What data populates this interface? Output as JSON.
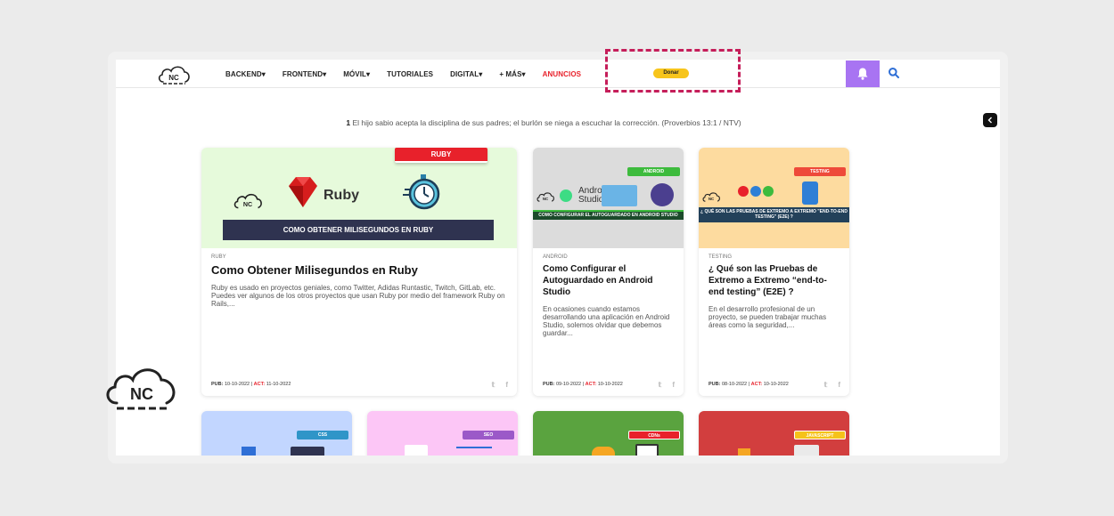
{
  "header": {
    "nav": [
      {
        "label": "BACKEND▾"
      },
      {
        "label": "FRONTEND▾"
      },
      {
        "label": "MÓVIL▾"
      },
      {
        "label": "TUTORIALES"
      },
      {
        "label": "DIGITAL▾"
      },
      {
        "label": "+ MÁS▾"
      },
      {
        "label": "ANUNCIOS"
      }
    ],
    "donate_label": "Donar",
    "logo_text": "NC"
  },
  "verse": {
    "number": "1",
    "text": " El hijo sabio acepta la disciplina de sus padres; el burlón se niega a escuchar la corrección. (Proverbios 13:1 / NTV)"
  },
  "cards": [
    {
      "tag": "RUBY",
      "image_brand": "Ruby",
      "image_banner": "COMO OBTENER MILISEGUNDOS EN RUBY",
      "category": "RUBY",
      "title": "Como Obtener Milisegundos en Ruby",
      "excerpt": "Ruby es usado en proyectos geniales, como Twitter, Adidas Runtastic, Twitch, GitLab, etc. Puedes ver algunos de los otros proyectos que usan Ruby por medio del framework Ruby on Rails,...",
      "pub_label": "PUB:",
      "pub": "10-10-2022",
      "act_label": "ACT:",
      "act": "11-10-2022"
    },
    {
      "tag": "ANDROID",
      "image_brand": "Android Studio",
      "image_banner": "COMO CONFIGURAR EL AUTOGUARDADO EN ANDROID STUDIO",
      "category": "ANDROID",
      "title": "Como Configurar el Autoguardado en Android Studio",
      "excerpt": "En ocasiones cuando estamos desarrollando una aplicación en Android Studio, solemos olvidar que debemos guardar...",
      "pub_label": "PUB:",
      "pub": "09-10-2022",
      "act_label": "ACT:",
      "act": "10-10-2022"
    },
    {
      "tag": "TESTING",
      "image_banner": "¿ QUÉ SON LAS PRUEBAS DE EXTREMO A EXTREMO \"END-TO-END TESTING\" (E2E) ?",
      "category": "TESTING",
      "title": "¿ Qué son las Pruebas de Extremo a Extremo “end-to-end testing” (E2E) ?",
      "excerpt": "En el desarrollo profesional de un proyecto, se pueden trabajar muchas áreas como la seguridad,...",
      "pub_label": "PUB:",
      "pub": "08-10-2022",
      "act_label": "ACT:",
      "act": "10-10-2022"
    }
  ],
  "bottom_cards": [
    {
      "tag": "CSS"
    },
    {
      "tag": "SEO"
    },
    {
      "tag": "CDNs"
    },
    {
      "tag": "JAVASCRIPT"
    }
  ],
  "colors": {
    "accent_purple": "#a874f2",
    "donate_yellow": "#f7c51c",
    "red": "#e8212b",
    "highlight": "#c51e5a"
  },
  "icons": [
    "cloud-logo-icon",
    "bell-icon",
    "search-icon",
    "collapse-icon",
    "twitter-icon",
    "facebook-icon",
    "stopwatch-icon",
    "ruby-gem-icon"
  ]
}
